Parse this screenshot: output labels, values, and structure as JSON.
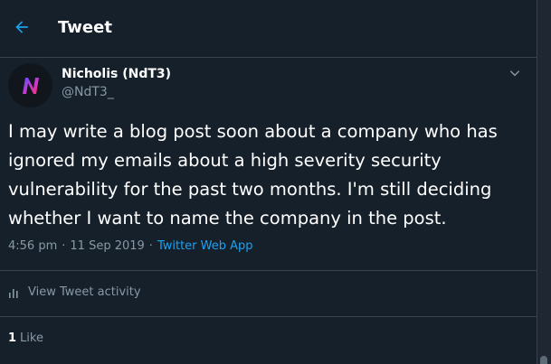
{
  "colors": {
    "background": "#15202b",
    "accent": "#1da1f2",
    "muted_text": "#8899a6",
    "divider": "#38444d"
  },
  "header": {
    "back_icon": "arrow-left-icon",
    "title": "Tweet"
  },
  "tweet": {
    "author": {
      "name": "Nicholis (NdT3)",
      "handle": "@NdT3_",
      "avatar_icon": "n-logo-avatar"
    },
    "menu_icon": "chevron-down-icon",
    "text": "I may write a blog post soon about a company who has\nignored my emails about a high severity security\nvulnerability for the past two months. I'm still deciding\nwhether I want to name the company in the post.",
    "time": "4:56 pm",
    "date": "11 Sep 2019",
    "separator": "·",
    "source_app": "Twitter Web App"
  },
  "activity": {
    "icon": "bar-chart-icon",
    "label": "View Tweet activity"
  },
  "likes": {
    "count": "1",
    "label": "Like"
  }
}
